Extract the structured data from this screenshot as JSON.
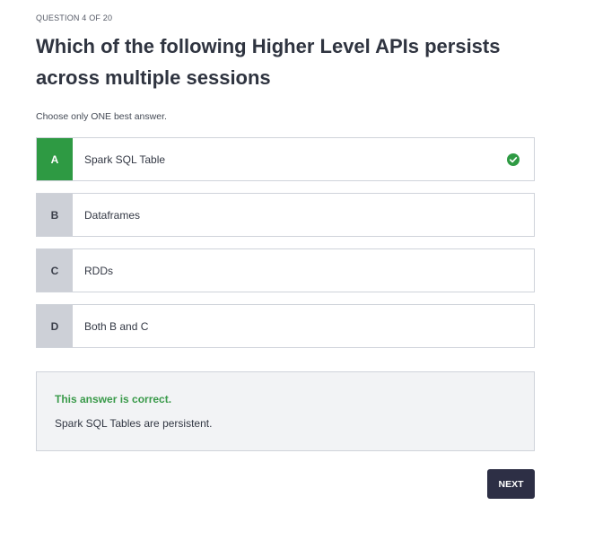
{
  "quiz": {
    "counter": "QUESTION 4 OF 20",
    "question": "Which of the following Higher Level APIs persists across multiple sessions",
    "instruction": "Choose only ONE best answer.",
    "options": [
      {
        "letter": "A",
        "text": "Spark SQL Table",
        "correct": true,
        "icon": "check-circle-icon"
      },
      {
        "letter": "B",
        "text": "Dataframes",
        "correct": false
      },
      {
        "letter": "C",
        "text": "RDDs",
        "correct": false
      },
      {
        "letter": "D",
        "text": "Both B and C",
        "correct": false
      }
    ],
    "feedback": {
      "title": "This answer is correct.",
      "text": "Spark SQL Tables are persistent."
    },
    "next_label": "NEXT"
  },
  "colors": {
    "correct_green": "#2e9a43",
    "feedback_green": "#3a9a4a",
    "letter_bg": "#cdd0d7",
    "next_button_bg": "#2d2f45",
    "feedback_bg": "#f2f3f5"
  }
}
